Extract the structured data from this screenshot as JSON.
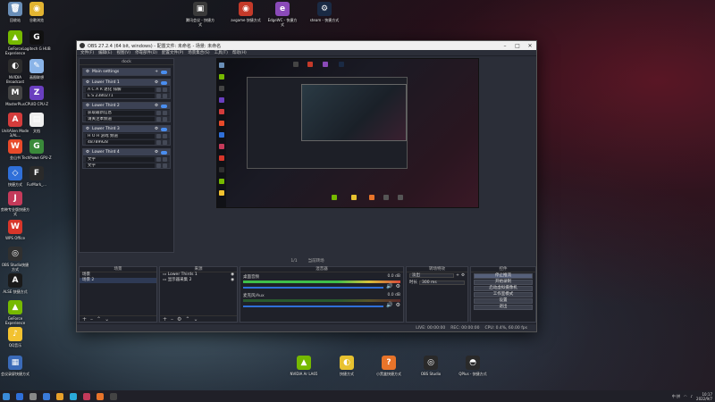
{
  "desktop": {
    "left_icons": [
      {
        "label": "回收站",
        "color": "#6a8fb8",
        "glyph": "🗑"
      },
      {
        "label": "谷歌浏览",
        "color": "#e2b431",
        "glyph": "◉"
      },
      {
        "label": "GeForce Experience",
        "color": "#76b900",
        "glyph": "▲"
      },
      {
        "label": "Logitech G HUB",
        "color": "#111",
        "glyph": "G"
      },
      {
        "label": "NVIDIA Broadcast",
        "color": "#2c2c2c",
        "glyph": "◐"
      },
      {
        "label": "画图联想",
        "color": "#8ab4e8",
        "glyph": "✎"
      },
      {
        "label": "MasterPlus",
        "color": "#444",
        "glyph": "M"
      },
      {
        "label": "CPUID CPU-Z",
        "color": "#6a3fbf",
        "glyph": "Z"
      },
      {
        "label": "UnitAlien Mode 3/AL...",
        "color": "#d43c3c",
        "glyph": "A"
      },
      {
        "label": "文档",
        "color": "#eee",
        "glyph": "▤"
      },
      {
        "label": "金山书",
        "color": "#e84a2a",
        "glyph": "W"
      },
      {
        "label": "TechPowe GPU-Z",
        "color": "#3a8a3a",
        "glyph": "G"
      },
      {
        "label": "快捷方式",
        "color": "#2f6fd8",
        "glyph": "◇"
      },
      {
        "label": "FurMark_...",
        "color": "#2a2a2a",
        "glyph": "F"
      },
      {
        "label": "剪映专业版快捷方式",
        "color": "#c43a5a",
        "glyph": "J"
      },
      {
        "label": "WPS Office",
        "color": "#d8362a",
        "glyph": "W"
      },
      {
        "label": "OBS Studio快捷方式",
        "color": "#303030",
        "glyph": "◎"
      },
      {
        "label": "ALSE 快捷方式",
        "color": "#1a1a1a",
        "glyph": "A"
      },
      {
        "label": "GeForce Experience",
        "color": "#76b900",
        "glyph": "▲"
      },
      {
        "label": "QQ音乐",
        "color": "#f2c230",
        "glyph": "♪"
      },
      {
        "label": "会议录屏快捷方式",
        "color": "#3a6ab8",
        "glyph": "▦"
      }
    ],
    "top_icons": [
      {
        "label": "腾讯会议 - 快捷方式",
        "color": "#3a3a3a",
        "glyph": "▣"
      },
      {
        "label": "avgame 快捷方式",
        "color": "#c43a2a",
        "glyph": "◉"
      },
      {
        "label": "EdgeWC - 快捷方式",
        "color": "#8a4ab8",
        "glyph": "e"
      },
      {
        "label": "steam - 快捷方式",
        "color": "#1a2a44",
        "glyph": "⚙"
      }
    ],
    "bottom_icons": [
      {
        "label": "NVIDIA Ar LA65",
        "color": "#76b900",
        "glyph": "▲"
      },
      {
        "label": "快捷方式",
        "color": "#e8c230",
        "glyph": "◐"
      },
      {
        "label": "小黑盒快捷方式",
        "color": "#e8742a",
        "glyph": "?"
      },
      {
        "label": "OBS Studio",
        "color": "#2a2a2a",
        "glyph": "◎"
      },
      {
        "label": "QPlus - 快捷方式",
        "color": "#2a2a2a",
        "glyph": "◓"
      }
    ]
  },
  "obs": {
    "title": "OBS 27.2.4 (64 bit, windows) - 配置文件: 未命名 - 场景: 未命名",
    "menu": [
      "文件(F)",
      "编辑(E)",
      "视图(V)",
      "停靠部件(D)",
      "配置文件(P)",
      "场景集合(S)",
      "工具(T)",
      "帮助(H)"
    ],
    "dock_title": "dock",
    "main_settings": "Main settings",
    "lower_thirds": [
      {
        "name": "Lower Third 1",
        "line1": "A C A R 退化 排解",
        "line2": "E S 2380271"
      },
      {
        "name": "Lower Third 2",
        "line1": "获取最新信息",
        "line2": "请关注本频道"
      },
      {
        "name": "Lower Third 3",
        "line1": "H O H 游戏 频道",
        "line2": "48789928"
      },
      {
        "name": "Lower Third 4",
        "line1": "文字",
        "line2": "文字"
      }
    ],
    "mid_bar": [
      "1/1",
      "当前转场"
    ],
    "scenes_header": "场景",
    "scenes": [
      "场景",
      "场景 2"
    ],
    "sources_header": "来源",
    "sources": [
      "Lower Thirds 1",
      "显示器采集 2"
    ],
    "mixer_header": "混音器",
    "mixer_tracks": [
      {
        "name": "桌面音频",
        "db": "0.0 dB"
      },
      {
        "name": "麦克风/Aux",
        "db": "0.0 dB"
      }
    ],
    "transitions_header": "转场特效",
    "transition_type": "淡出",
    "transition_duration_label": "时长",
    "transition_duration": "300 ms",
    "controls_header": "控件",
    "controls": [
      "停止推流",
      "开始录制",
      "启动虚拟摄像机",
      "工作室模式",
      "设置",
      "退出"
    ],
    "status": {
      "live": "LIVE: 00:00:00",
      "rec": "REC: 00:00:00",
      "cpu": "CPU: 0.4%, 60.00 fps"
    }
  },
  "taskbar": {
    "icons": [
      "#2f6fd8",
      "#888",
      "#3a7ad8",
      "#e8a02a",
      "#2aa8d8",
      "#c43a5a",
      "#e8742a",
      "#444"
    ],
    "tray_text": "中 拼",
    "time": "10:17",
    "date": "2022/9/7"
  }
}
